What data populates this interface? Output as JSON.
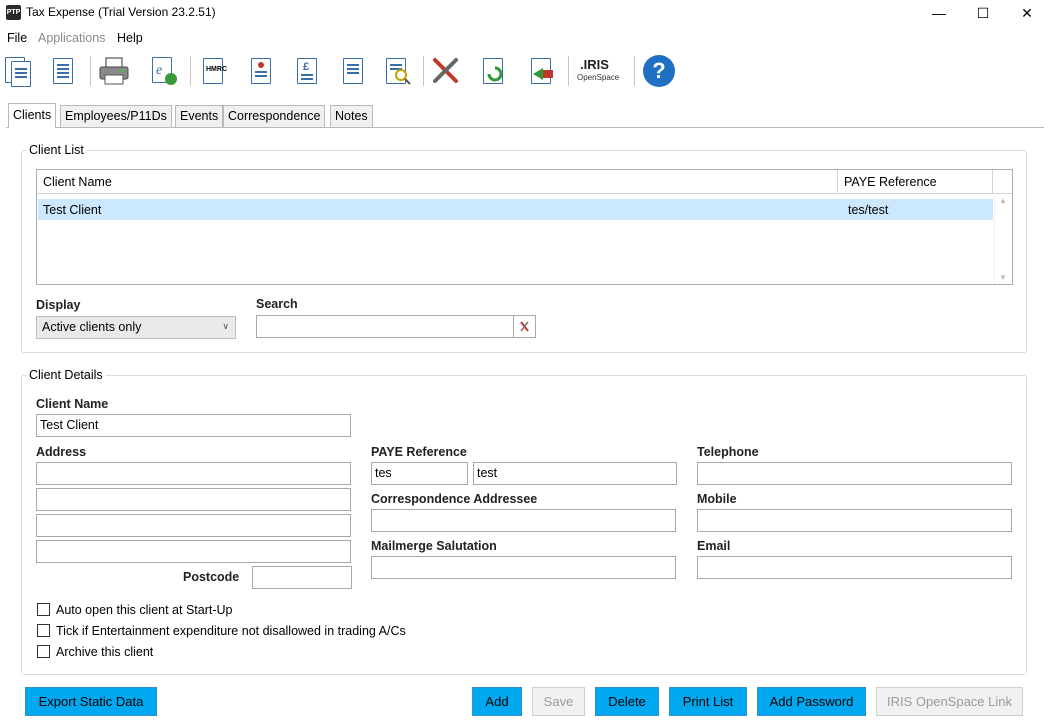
{
  "window": {
    "app_icon": "PTP",
    "title": "Tax Expense (Trial Version 23.2.51)",
    "controls": {
      "minimize": "—",
      "maximize": "☐",
      "close": "✕"
    }
  },
  "menu": [
    "File",
    "Applications",
    "Help"
  ],
  "toolbar": {
    "iris_brand": ".IRIS",
    "iris_sub": "OpenSpace",
    "help_glyph": "?",
    "hmrc_text": "HMRC",
    "pound_text": "£"
  },
  "tabs": [
    "Clients",
    "Employees/P11Ds",
    "Events",
    "Correspondence",
    "Notes"
  ],
  "client_list": {
    "title": "Client List",
    "columns": [
      "Client Name",
      "PAYE Reference"
    ],
    "rows": [
      {
        "name": "Test Client",
        "paye": "tes/test"
      }
    ],
    "display_label": "Display",
    "display_value": "Active clients only",
    "search_label": "Search",
    "search_value": ""
  },
  "client_details": {
    "title": "Client Details",
    "client_name_label": "Client Name",
    "client_name": "Test Client",
    "address_label": "Address",
    "address": [
      "",
      "",
      "",
      ""
    ],
    "postcode_label": "Postcode",
    "postcode": "",
    "paye_label": "PAYE Reference",
    "paye_office": "tes",
    "paye_ref": "test",
    "addressee_label": "Correspondence Addressee",
    "addressee": "",
    "salutation_label": "Mailmerge Salutation",
    "salutation": "",
    "telephone_label": "Telephone",
    "telephone": "",
    "mobile_label": "Mobile",
    "mobile": "",
    "email_label": "Email",
    "email": "",
    "checkboxes": [
      {
        "label": "Auto open this client at Start-Up",
        "checked": false
      },
      {
        "label": "Tick if Entertainment expenditure not disallowed in trading A/Cs",
        "checked": false
      },
      {
        "label": "Archive this client",
        "checked": false
      }
    ]
  },
  "buttons": {
    "export": "Export Static Data",
    "add": "Add",
    "save": "Save",
    "delete": "Delete",
    "print": "Print List",
    "add_password": "Add Password",
    "iris_link": "IRIS OpenSpace Link"
  },
  "colors": {
    "accent": "#00a8ef",
    "selection": "#cce8ff",
    "help": "#1f6fc2"
  }
}
